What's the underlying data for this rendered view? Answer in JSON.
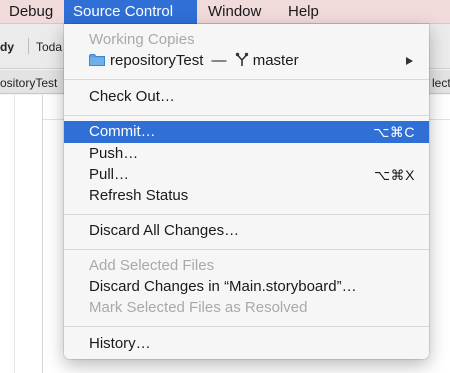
{
  "menubar": {
    "items": [
      {
        "label": "Debug"
      },
      {
        "label": "Source Control"
      },
      {
        "label": "Window"
      },
      {
        "label": "Help"
      }
    ]
  },
  "background": {
    "toolbar_text_a": "dy",
    "toolbar_text_b": "Toda",
    "tab_left": "ositoryTest",
    "tab_right": "lect"
  },
  "menu": {
    "working_copies_header": "Working Copies",
    "repo_label": "repositoryTest",
    "repo_separator": "—",
    "branch_label": "master",
    "check_out": "Check Out…",
    "commit": "Commit…",
    "commit_shortcut": "⌥⌘C",
    "push": "Push…",
    "pull": "Pull…",
    "pull_shortcut": "⌥⌘X",
    "refresh_status": "Refresh Status",
    "discard_all": "Discard All Changes…",
    "add_selected": "Add Selected Files",
    "discard_in_file": "Discard Changes in “Main.storyboard”…",
    "mark_resolved": "Mark Selected Files as Resolved",
    "history": "History…"
  },
  "colors": {
    "accent": "#2f6fd6",
    "menubar_bg": "#f0dada",
    "folder_icon": "#5aa2e0"
  },
  "icons": {
    "repo": "folder-icon",
    "branch": "branch-icon",
    "submenu": "submenu-arrow-icon"
  }
}
